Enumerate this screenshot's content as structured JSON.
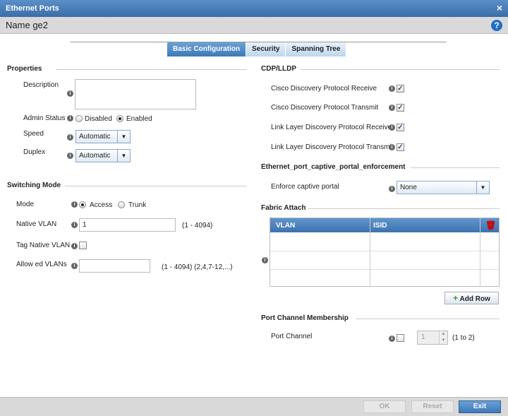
{
  "window": {
    "title": "Ethernet Ports",
    "name_label": "Name",
    "name_value": "ge2"
  },
  "tabs": [
    {
      "label": "Basic Configuration",
      "active": true
    },
    {
      "label": "Security",
      "active": false
    },
    {
      "label": "Spanning Tree",
      "active": false
    }
  ],
  "properties": {
    "heading": "Properties",
    "description_label": "Description",
    "description_value": "",
    "admin_status_label": "Admin Status",
    "admin_disabled": "Disabled",
    "admin_enabled": "Enabled",
    "speed_label": "Speed",
    "speed_value": "Automatic",
    "duplex_label": "Duplex",
    "duplex_value": "Automatic"
  },
  "switching": {
    "heading": "Switching Mode",
    "mode_label": "Mode",
    "mode_access": "Access",
    "mode_trunk": "Trunk",
    "native_vlan_label": "Native VLAN",
    "native_vlan_value": "1",
    "native_vlan_range": "(1 - 4094)",
    "tag_native_vlan_label": "Tag Native VLAN",
    "allowed_vlans_label": "Allow ed VLANs",
    "allowed_vlans_value": "",
    "allowed_vlans_hint": "(1 - 4094)  (2,4,7-12,...)"
  },
  "cdp": {
    "heading": "CDP/LLDP",
    "items": [
      {
        "label": "Cisco Discovery Protocol Receive",
        "checked": true
      },
      {
        "label": "Cisco Discovery Protocol Transmit",
        "checked": true
      },
      {
        "label": "Link Layer Discovery Protocol Receive",
        "checked": true
      },
      {
        "label": "Link Layer Discovery Protocol Transmit",
        "checked": true
      }
    ]
  },
  "captive": {
    "heading": "Ethernet_port_captive_portal_enforcement",
    "enforce_label": "Enforce captive portal",
    "enforce_value": "None"
  },
  "fabric": {
    "heading": "Fabric Attach",
    "col_vlan": "VLAN",
    "col_isid": "ISID",
    "add_row": "Add Row"
  },
  "port_channel": {
    "heading": "Port Channel Membership",
    "label": "Port Channel",
    "value": "1",
    "range": "(1 to 2)"
  },
  "footer": {
    "ok": "OK",
    "reset": "Reset",
    "exit": "Exit"
  },
  "icons": {
    "close": "×",
    "help": "?",
    "info": "i",
    "check": "✓",
    "arrow": "▼",
    "trash": "🗑",
    "plus": "+"
  }
}
